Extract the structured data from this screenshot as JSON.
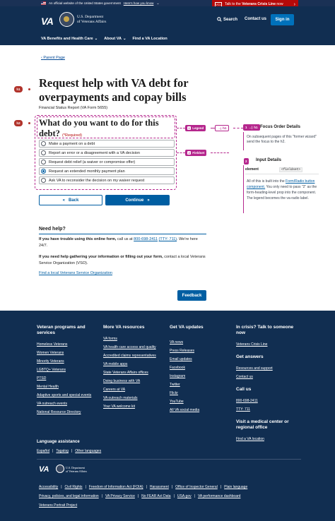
{
  "gov_banner": {
    "text": "An official website of the United States government",
    "link": "Here's how you know"
  },
  "crisis_banner": {
    "prefix": "Talk to the ",
    "bold": "Veterans Crisis Line",
    "suffix": " now",
    "icon_text": "VCL"
  },
  "header": {
    "logo": "VA",
    "dept_line1": "U.S. Department",
    "dept_line2": "of Veterans Affairs",
    "search": "Search",
    "contact": "Contact us",
    "signin": "Sign in",
    "nav": [
      "VA Benefits and Health Care",
      "About VA",
      "Find a VA Location"
    ]
  },
  "breadcrumb": "Parent Page",
  "page": {
    "title": "Request help with VA debt for overpayments and copay bills",
    "form_number": "Financial Status Report (VA Form 5655)",
    "legend": "What do you want to do for this debt?",
    "required": "(*Required)",
    "options": [
      {
        "label": "Make a payment on a debt",
        "selected": false
      },
      {
        "label": "Report an error or a disagreement with a VA decision",
        "selected": false
      },
      {
        "label": "Request debt relief (a waiver or compromise offer)",
        "selected": false
      },
      {
        "label": "Request an extended monthly payment plan",
        "selected": true
      },
      {
        "label": "Ask VA to reconsider the decision on my waiver request",
        "selected": false
      }
    ],
    "back": "Back",
    "continue": "Continue"
  },
  "annotations": {
    "h1_pin": "h1",
    "h2_pin": "h2",
    "legend_tag": {
      "num": "1",
      "label": "Legend"
    },
    "legend_h1": "h1",
    "fieldset_tag": {
      "num": "2",
      "label": "Fieldset"
    },
    "focus_title": "Focus Order Details",
    "focus_num": "1",
    "focus_sub": "h1",
    "focus_body": "On subsequent pages of this \"former wizard\" send the focus to the h2.",
    "input_title": "Input Details",
    "input_num": "2",
    "table_key": "element",
    "table_val": "<fieldset>",
    "input_body_1": "All of this is built into the ",
    "input_body_link": "Form/Radio button component.",
    "input_body_2": " You only need to pass \"2\" as the form-heading-level prop into the component. The legend becomes the va-radio label."
  },
  "help": {
    "title": "Need help?",
    "p1_bold": "If you have trouble using this online form,",
    "p1_mid": " call us at ",
    "p1_phone": "800-698-2411",
    "p1_tty": "(TTY: 711)",
    "p1_end": ". We're here 24/7.",
    "p2_bold": "If you need help gathering your information or filling out your form,",
    "p2_rest": " contact a local Veterans Service Organization (VSO).",
    "link": "Find a local Veterans Service Organization",
    "feedback": "Feedback"
  },
  "footer": {
    "col1": {
      "title": "Veteran programs and services",
      "links": [
        "Homeless Veterans",
        "Women Veterans",
        "Minority Veterans",
        "LGBTQ+ Veterans",
        "PTSD",
        "Mental Health",
        "Adaptive sports and special events",
        "VA outreach events",
        "National Resource Directory"
      ]
    },
    "col2": {
      "title": "More VA resources",
      "links": [
        "VA forms",
        "VA health care access and quality",
        "Accredited claims representatives",
        "VA mobile apps",
        "State Veterans Affairs offices",
        "Doing business with VA",
        "Careers at VA",
        "VA outreach materials",
        "Your VA welcome kit"
      ]
    },
    "col3": {
      "title": "Get VA updates",
      "links": [
        "VA news",
        "Press Releases",
        "Email updates",
        "Facebook",
        "Instagram",
        "Twitter",
        "Flickr",
        "YouTube",
        "All VA social media"
      ]
    },
    "col4": {
      "title": "In crisis? Talk to someone now",
      "crisis_link": "Veterans Crisis Line",
      "answers_title": "Get answers",
      "answers": [
        "Resources and support",
        "Contact us"
      ],
      "call_title": "Call us",
      "calls": [
        "800-698-2411",
        "TTY: 711"
      ],
      "visit_title": "Visit a medical center or regional office",
      "visit_link": "Find a VA location"
    },
    "lang_title": "Language assistance",
    "langs": [
      "Español",
      "Tagalog",
      "Other languages"
    ],
    "logo": "VA",
    "dept_line1": "U.S. Department",
    "dept_line2": "of Veterans Affairs",
    "row1": [
      "Accessibility",
      "Civil Rights",
      "Freedom of Information Act (FOIA)",
      "Harassment",
      "Office of Inspector General",
      "Plain language"
    ],
    "row2": [
      "Privacy, policies, and legal information",
      "VA Privacy Service",
      "No FEAR Act Data",
      "USA.gov",
      "VA performance dashboard"
    ],
    "row3": [
      "Veterans Portrait Project"
    ]
  }
}
